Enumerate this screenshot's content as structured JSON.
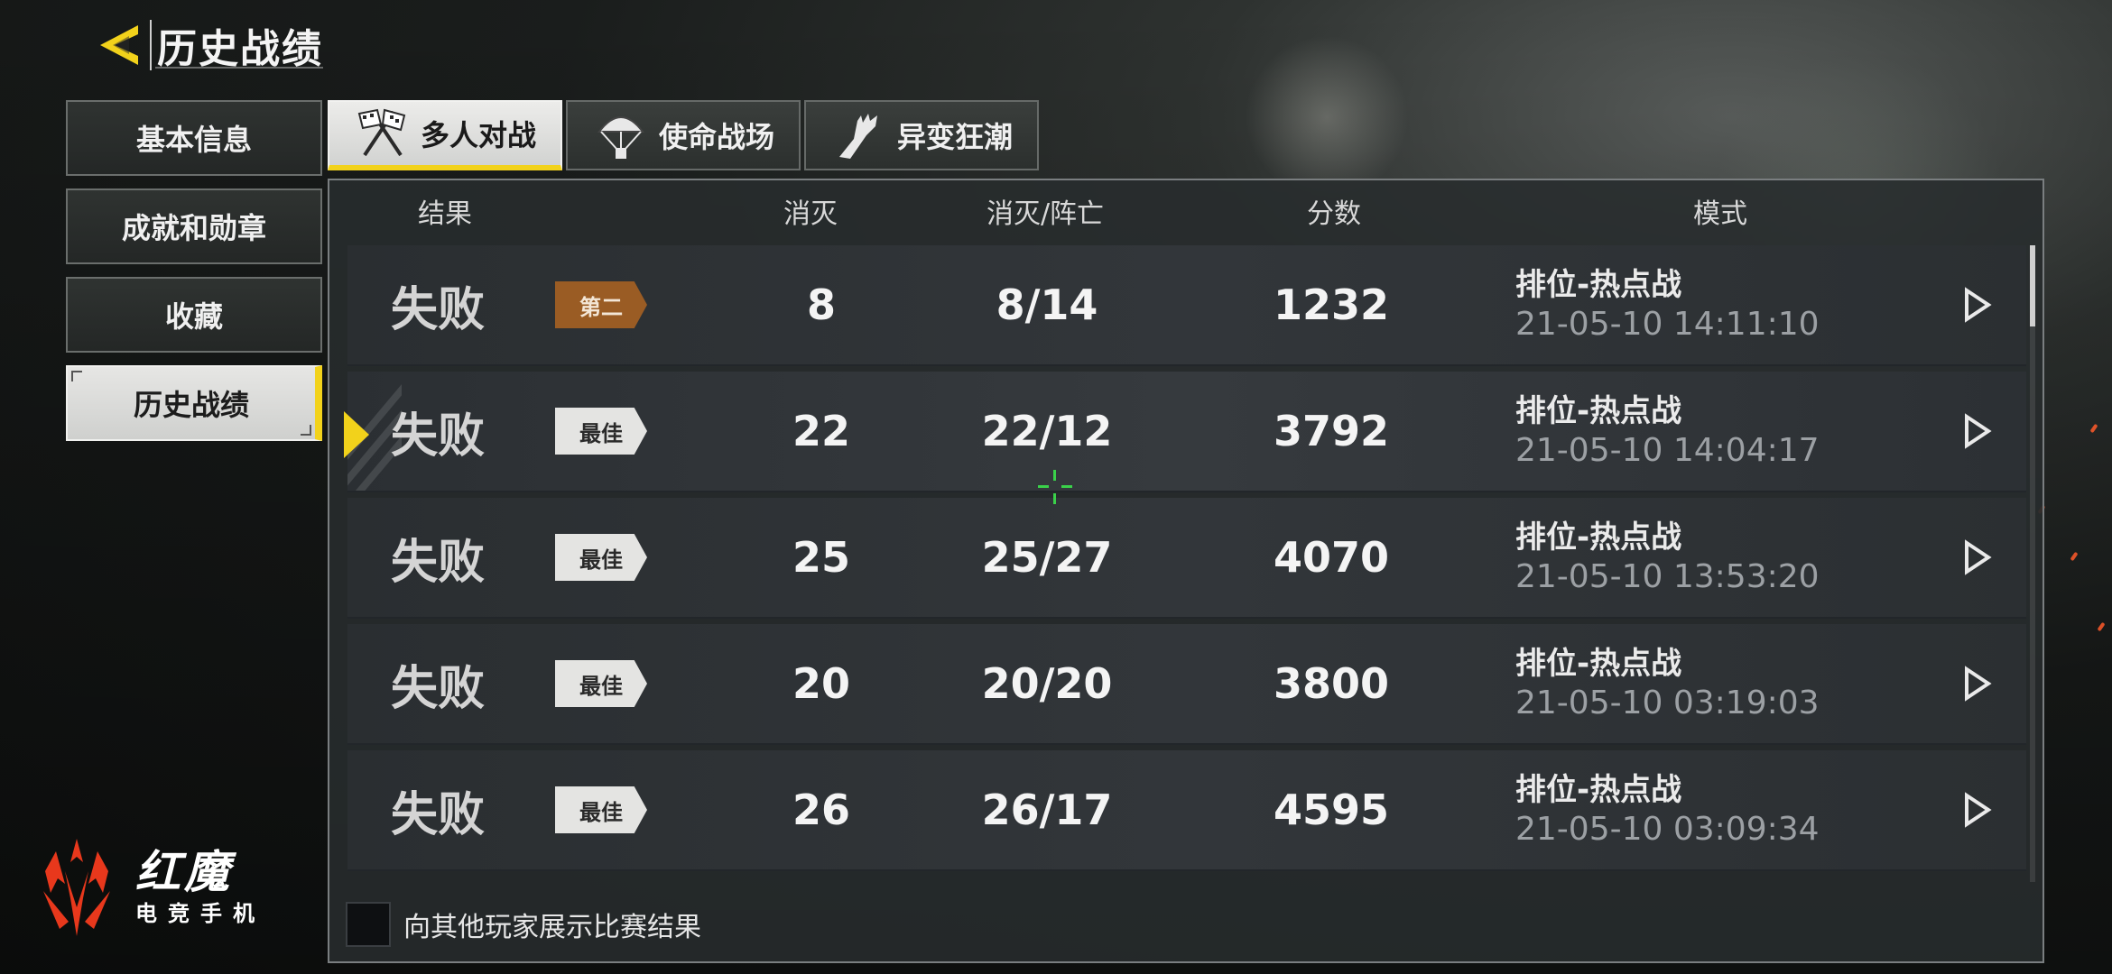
{
  "header": {
    "title": "历史战绩"
  },
  "sidebar": {
    "items": [
      {
        "label": "基本信息",
        "active": false
      },
      {
        "label": "成就和勋章",
        "active": false
      },
      {
        "label": "收藏",
        "active": false
      },
      {
        "label": "历史战绩",
        "active": true
      }
    ]
  },
  "tabs": [
    {
      "label": "多人对战",
      "icon": "crossed-flags-icon",
      "active": true
    },
    {
      "label": "使命战场",
      "icon": "parachute-icon",
      "active": false
    },
    {
      "label": "异变狂潮",
      "icon": "zombie-hand-icon",
      "active": false
    }
  ],
  "table": {
    "columns": [
      "结果",
      "消灭",
      "消灭/阵亡",
      "分数",
      "模式"
    ],
    "rows": [
      {
        "result": "失败",
        "badge": "第二",
        "badge_type": "second",
        "kills": "8",
        "kd": "8/14",
        "score": "1232",
        "mode": "排位-热点战",
        "time": "21-05-10 14:11:10",
        "selected": false
      },
      {
        "result": "失败",
        "badge": "最佳",
        "badge_type": "best",
        "kills": "22",
        "kd": "22/12",
        "score": "3792",
        "mode": "排位-热点战",
        "time": "21-05-10 14:04:17",
        "selected": true
      },
      {
        "result": "失败",
        "badge": "最佳",
        "badge_type": "best",
        "kills": "25",
        "kd": "25/27",
        "score": "4070",
        "mode": "排位-热点战",
        "time": "21-05-10 13:53:20",
        "selected": false
      },
      {
        "result": "失败",
        "badge": "最佳",
        "badge_type": "best",
        "kills": "20",
        "kd": "20/20",
        "score": "3800",
        "mode": "排位-热点战",
        "time": "21-05-10 03:19:03",
        "selected": false
      },
      {
        "result": "失败",
        "badge": "最佳",
        "badge_type": "best",
        "kills": "26",
        "kd": "26/17",
        "score": "4595",
        "mode": "排位-热点战",
        "time": "21-05-10 03:09:34",
        "selected": false
      }
    ]
  },
  "share": {
    "label": "向其他玩家展示比赛结果",
    "checked": false
  },
  "brand": {
    "name": "红魔",
    "subtitle": "电竞手机"
  },
  "colors": {
    "accent": "#f2d21b",
    "badge_second": "#9a5c24",
    "badge_best": "#e4e4e2",
    "brand_red": "#e8381c"
  }
}
